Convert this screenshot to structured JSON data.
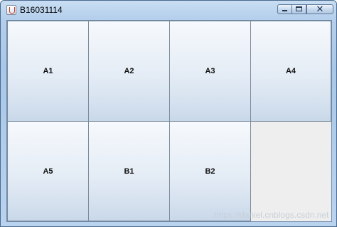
{
  "window": {
    "title": "B16031114",
    "controls": {
      "minimize_icon": "minimize-icon",
      "maximize_icon": "maximize-icon",
      "close_icon": "close-icon",
      "close_glyph": "✕"
    }
  },
  "buttons": [
    {
      "label": "A1"
    },
    {
      "label": "A2"
    },
    {
      "label": "A3"
    },
    {
      "label": "A4"
    },
    {
      "label": "A5"
    },
    {
      "label": "B1"
    },
    {
      "label": "B2"
    }
  ],
  "watermark": "https://daniel.cnblogs.csdn.net"
}
